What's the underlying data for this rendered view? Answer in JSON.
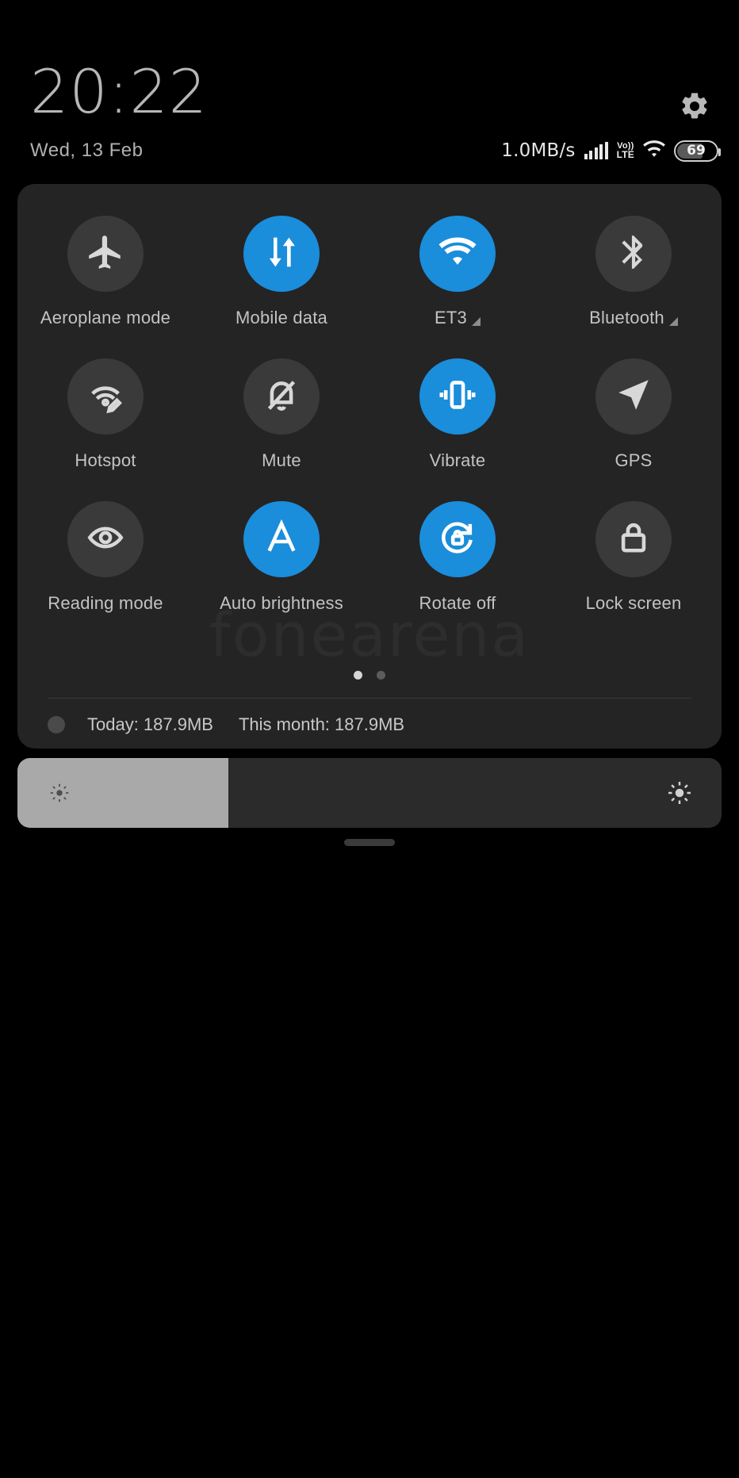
{
  "header": {
    "clock": "20:22",
    "date": "Wed, 13 Feb",
    "gear_icon": "gear-icon"
  },
  "statusbar": {
    "network_speed": "1.0MB/s",
    "signal_icon": "signal-bars-icon",
    "volte_top": "Vo))",
    "volte_bottom": "LTE",
    "wifi_icon": "wifi-icon",
    "battery_level": "69"
  },
  "quick_settings": {
    "watermark": "fonearena",
    "tiles": [
      {
        "label": "Aeroplane mode",
        "icon": "airplane-icon",
        "active": false,
        "expandable": false
      },
      {
        "label": "Mobile data",
        "icon": "data-arrows-icon",
        "active": true,
        "expandable": false
      },
      {
        "label": "ET3",
        "icon": "wifi-icon",
        "active": true,
        "expandable": true
      },
      {
        "label": "Bluetooth",
        "icon": "bluetooth-icon",
        "active": false,
        "expandable": true
      },
      {
        "label": "Hotspot",
        "icon": "hotspot-icon",
        "active": false,
        "expandable": false
      },
      {
        "label": "Mute",
        "icon": "bell-off-icon",
        "active": false,
        "expandable": false
      },
      {
        "label": "Vibrate",
        "icon": "vibrate-icon",
        "active": true,
        "expandable": false
      },
      {
        "label": "GPS",
        "icon": "location-arrow-icon",
        "active": false,
        "expandable": false
      },
      {
        "label": "Reading mode",
        "icon": "eye-icon",
        "active": false,
        "expandable": false
      },
      {
        "label": "Auto brightness",
        "icon": "auto-brightness-a-icon",
        "active": true,
        "expandable": false
      },
      {
        "label": "Rotate off",
        "icon": "rotate-lock-icon",
        "active": true,
        "expandable": false
      },
      {
        "label": "Lock screen",
        "icon": "padlock-icon",
        "active": false,
        "expandable": false
      }
    ],
    "pages": {
      "count": 2,
      "active_index": 0
    },
    "data_usage": {
      "today_label": "Today: 187.9MB",
      "month_label": "This month: 187.9MB"
    }
  },
  "brightness": {
    "level_percent": 30,
    "low_icon": "brightness-low-icon",
    "high_icon": "brightness-high-icon"
  },
  "colors": {
    "accent": "#1a8ddb",
    "panel": "#242424",
    "tile_off": "#3a3a3a",
    "slider_track": "#2b2b2b",
    "slider_fill": "#a9a9a9",
    "text": "#c3c3c3"
  }
}
